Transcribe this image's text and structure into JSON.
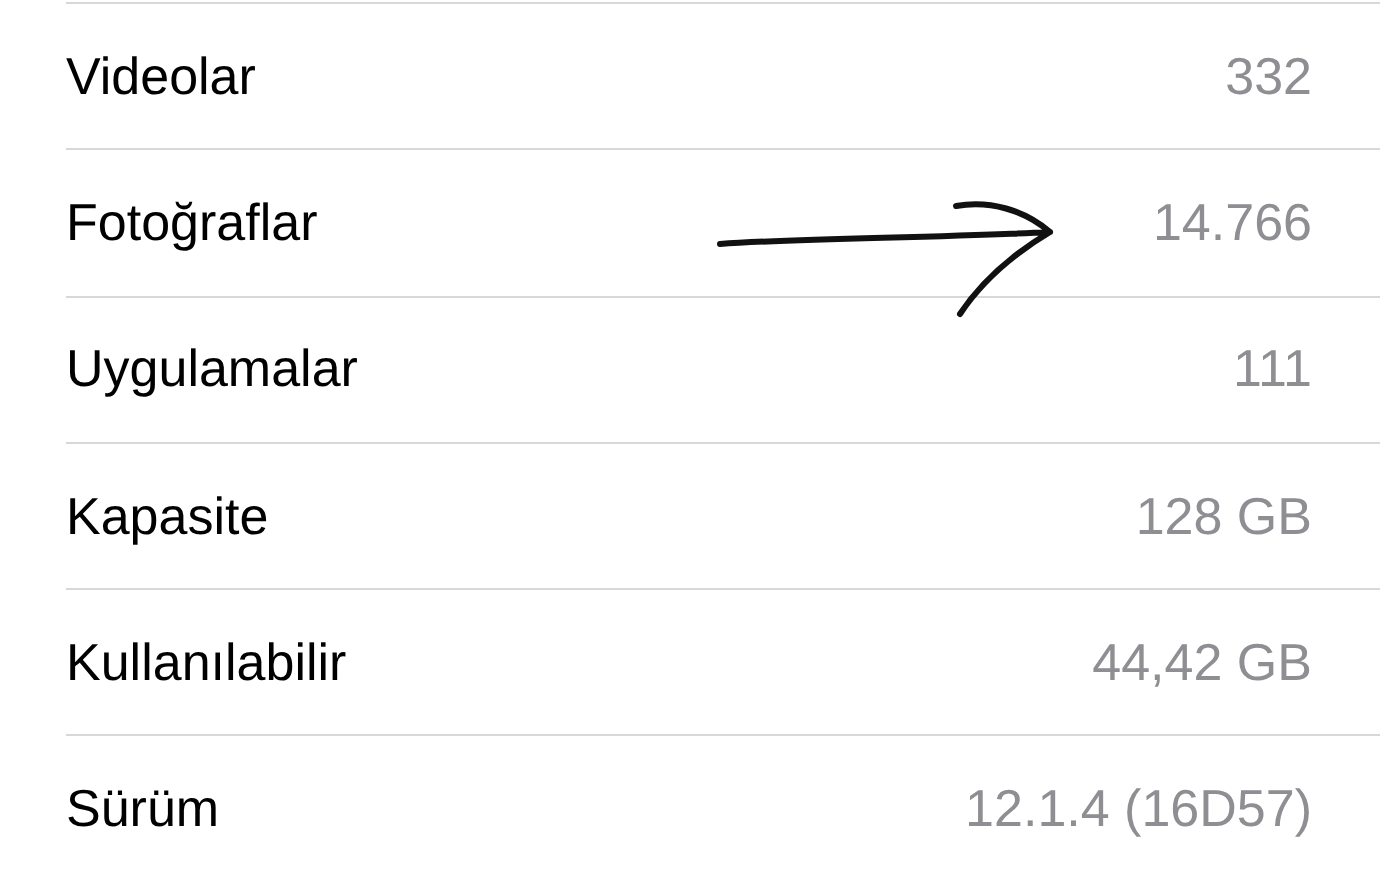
{
  "rows": [
    {
      "label": "Videolar",
      "value": "332"
    },
    {
      "label": "Fotoğraflar",
      "value": "14.766"
    },
    {
      "label": "Uygulamalar",
      "value": "111"
    },
    {
      "label": "Kapasite",
      "value": "128 GB"
    },
    {
      "label": "Kullanılabilir",
      "value": "44,42 GB"
    },
    {
      "label": "Sürüm",
      "value": "12.1.4 (16D57)"
    }
  ]
}
